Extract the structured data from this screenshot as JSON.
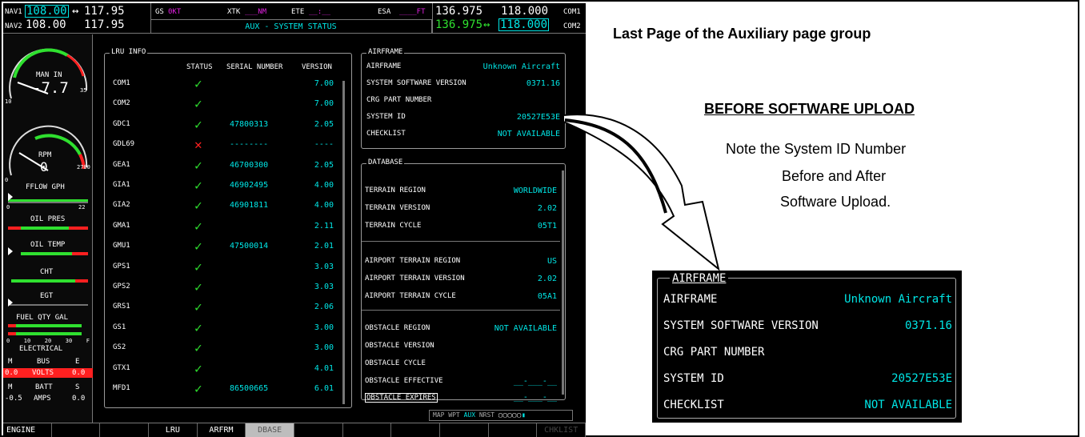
{
  "topbar": {
    "nav1_label": "NAV1",
    "nav1_active": "108.00",
    "nav1_arrow": "↔",
    "nav1_standby": "117.95",
    "nav2_label": "NAV2",
    "nav2_active": "108.00",
    "nav2_standby": "117.95",
    "gs_label": "GS",
    "gs_value": "0KT",
    "xtk_label": "XTK",
    "xtk_value": "___NM",
    "ete_label": "ETE",
    "ete_value": "__:__",
    "esa_label": "ESA",
    "esa_value": "____FT",
    "page_title": "AUX - SYSTEM STATUS",
    "com1_standby": "136.975",
    "com1_active": "118.000",
    "com1_label": "COM1",
    "com2_standby": "136.975",
    "com2_arrow": "↔",
    "com2_active": "118.000",
    "com2_label": "COM2"
  },
  "engine": {
    "man_in_label": "MAN IN",
    "man_in_value": "-7.7",
    "man_in_min": "10",
    "man_in_max": "35",
    "rpm_label": "RPM",
    "rpm_value": "0",
    "rpm_min": "0",
    "rpm_max": "2700",
    "fflow_label": "FFLOW GPH",
    "fflow_min": "0",
    "fflow_max": "22",
    "oil_pres_label": "OIL PRES",
    "oil_temp_label": "OIL TEMP",
    "cht_label": "CHT",
    "egt_label": "EGT",
    "fuel_qty_label": "FUEL QTY GAL",
    "fuel_scale": [
      "0",
      "10",
      "20",
      "30",
      "F"
    ],
    "electrical_label": "ELECTRICAL",
    "bus_m": "M",
    "bus_label": "BUS",
    "bus_e": "E",
    "volts_m": "0.0",
    "volts_label": "VOLTS",
    "volts_e": "0.0",
    "batt_m": "M",
    "batt_label": "BATT",
    "batt_s": "S",
    "amps_m": "-0.5",
    "amps_label": "AMPS",
    "amps_s": "0.0"
  },
  "lru": {
    "title": "LRU INFO",
    "headers": {
      "status": "STATUS",
      "serial": "SERIAL NUMBER",
      "version": "VERSION"
    },
    "rows": [
      {
        "name": "COM1",
        "status": "ok",
        "serial": "",
        "version": "7.00"
      },
      {
        "name": "COM2",
        "status": "ok",
        "serial": "",
        "version": "7.00"
      },
      {
        "name": "GDC1",
        "status": "ok",
        "serial": "47800313",
        "version": "2.05"
      },
      {
        "name": "GDL69",
        "status": "fail",
        "serial": "--------",
        "version": "----"
      },
      {
        "name": "GEA1",
        "status": "ok",
        "serial": "46700300",
        "version": "2.05"
      },
      {
        "name": "GIA1",
        "status": "ok",
        "serial": "46902495",
        "version": "4.00"
      },
      {
        "name": "GIA2",
        "status": "ok",
        "serial": "46901811",
        "version": "4.00"
      },
      {
        "name": "GMA1",
        "status": "ok",
        "serial": "",
        "version": "2.11"
      },
      {
        "name": "GMU1",
        "status": "ok",
        "serial": "47500014",
        "version": "2.01"
      },
      {
        "name": "GPS1",
        "status": "ok",
        "serial": "",
        "version": "3.03"
      },
      {
        "name": "GPS2",
        "status": "ok",
        "serial": "",
        "version": "3.03"
      },
      {
        "name": "GRS1",
        "status": "ok",
        "serial": "",
        "version": "2.06"
      },
      {
        "name": "GS1",
        "status": "ok",
        "serial": "",
        "version": "3.00"
      },
      {
        "name": "GS2",
        "status": "ok",
        "serial": "",
        "version": "3.00"
      },
      {
        "name": "GTX1",
        "status": "ok",
        "serial": "",
        "version": "4.01"
      },
      {
        "name": "MFD1",
        "status": "ok",
        "serial": "86500665",
        "version": "6.01"
      }
    ]
  },
  "airframe": {
    "title": "AIRFRAME",
    "rows": [
      {
        "label": "AIRFRAME",
        "value": "Unknown Aircraft"
      },
      {
        "label": "SYSTEM SOFTWARE VERSION",
        "value": "0371.16"
      },
      {
        "label": "CRG PART NUMBER",
        "value": ""
      },
      {
        "label": "SYSTEM ID",
        "value": "20527E53E"
      },
      {
        "label": "CHECKLIST",
        "value": "NOT AVAILABLE"
      }
    ]
  },
  "database": {
    "title": "DATABASE",
    "rows": [
      {
        "label": "TERRAIN REGION",
        "value": "WORLDWIDE"
      },
      {
        "label": "TERRAIN VERSION",
        "value": "2.02"
      },
      {
        "label": "TERRAIN CYCLE",
        "value": "05T1"
      },
      {
        "label": "AIRPORT TERRAIN REGION",
        "value": "US"
      },
      {
        "label": "AIRPORT TERRAIN VERSION",
        "value": "2.02"
      },
      {
        "label": "AIRPORT TERRAIN CYCLE",
        "value": "05A1"
      },
      {
        "label": "OBSTACLE REGION",
        "value": "NOT AVAILABLE"
      },
      {
        "label": "OBSTACLE VERSION",
        "value": ""
      },
      {
        "label": "OBSTACLE CYCLE",
        "value": ""
      },
      {
        "label": "OBSTACLE EFFECTIVE",
        "value": "__-___-__"
      },
      {
        "label": "OBSTACLE EXPIRES",
        "value": "__-___-__"
      }
    ]
  },
  "page_group": {
    "labels": [
      "MAP",
      "WPT",
      "AUX",
      "NRST"
    ],
    "active": "AUX"
  },
  "softkeys": [
    "ENGINE",
    "",
    "",
    "LRU",
    "ARFRM",
    "DBASE",
    "",
    "",
    "",
    "",
    "",
    "CHKLIST"
  ],
  "annotations": {
    "heading": "Last Page of the Auxiliary page group",
    "subheading": "BEFORE SOFTWARE UPLOAD",
    "note_line1": "Note the System ID Number",
    "note_line2": "Before and After",
    "note_line3": "Software Upload."
  },
  "inset": {
    "title": "AIRFRAME",
    "rows": [
      {
        "label": "AIRFRAME",
        "value": "Unknown Aircraft"
      },
      {
        "label": "SYSTEM SOFTWARE VERSION",
        "value": "0371.16"
      },
      {
        "label": "CRG PART NUMBER",
        "value": ""
      },
      {
        "label": "SYSTEM ID",
        "value": "20527E53E"
      },
      {
        "label": "CHECKLIST",
        "value": "NOT AVAILABLE"
      }
    ]
  },
  "colors": {
    "cyan": "#00e6e6",
    "green": "#2fe02f",
    "red": "#ff2020",
    "magenta": "#e020e0"
  }
}
